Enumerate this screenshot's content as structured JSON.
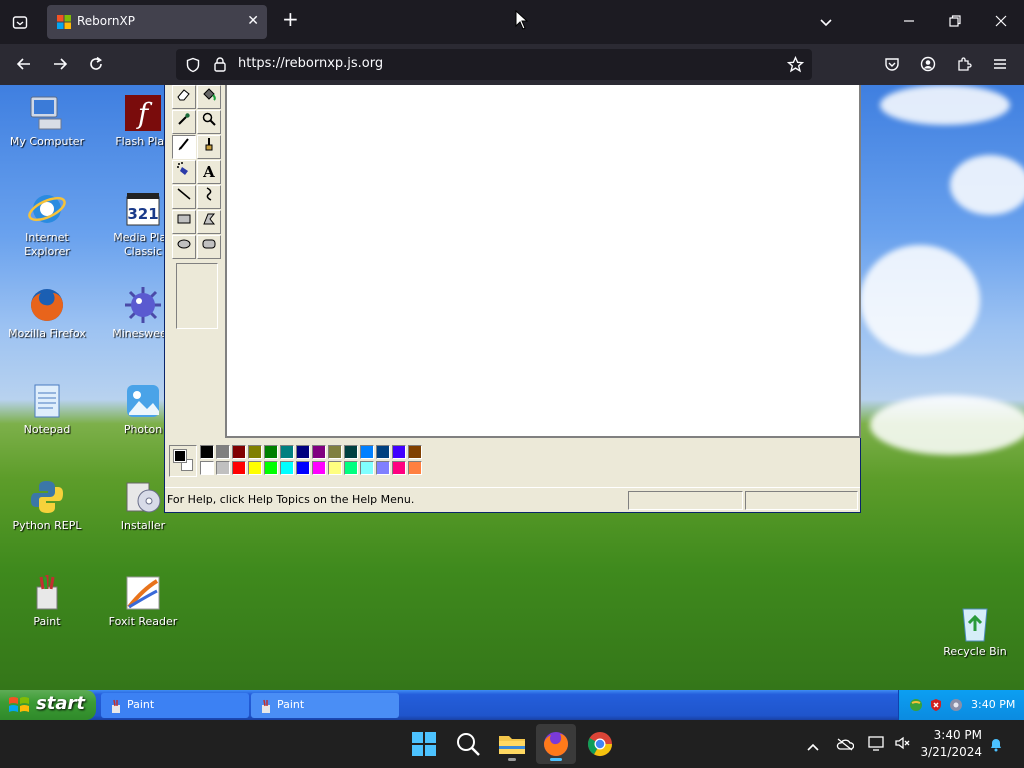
{
  "browser": {
    "tab_title": "RebornXP",
    "url": "https://rebornxp.js.org",
    "new_tab_symbol": "+",
    "close_symbol": "✕"
  },
  "desktop": {
    "icons": [
      {
        "label": "My Computer"
      },
      {
        "label": "Flash Play"
      },
      {
        "label": "Internet\nExplorer"
      },
      {
        "label": "Media Play\nClassic"
      },
      {
        "label": "Mozilla Firefox"
      },
      {
        "label": "Minesweep"
      },
      {
        "label": "Notepad"
      },
      {
        "label": "Photon"
      },
      {
        "label": "Python REPL"
      },
      {
        "label": "Installer"
      },
      {
        "label": "Paint"
      },
      {
        "label": "Foxit Reader"
      },
      {
        "label": "Recycle Bin"
      }
    ]
  },
  "paint": {
    "text_tool_glyph": "A",
    "status": "For Help, click Help Topics on the Help Menu.",
    "palette_top": [
      "#000000",
      "#808080",
      "#800000",
      "#808000",
      "#008000",
      "#008080",
      "#000080",
      "#800080",
      "#808040",
      "#004040",
      "#0080ff",
      "#004080",
      "#4000ff",
      "#804000"
    ],
    "palette_bottom": [
      "#ffffff",
      "#c0c0c0",
      "#ff0000",
      "#ffff00",
      "#00ff00",
      "#00ffff",
      "#0000ff",
      "#ff00ff",
      "#ffff80",
      "#00ff80",
      "#80ffff",
      "#8080ff",
      "#ff0080",
      "#ff8040"
    ]
  },
  "xp_taskbar": {
    "start_label": "start",
    "tasks": [
      "Paint",
      "Paint"
    ],
    "time": "3:40 PM"
  },
  "win_taskbar": {
    "time": "3:40 PM",
    "date": "3/21/2024"
  }
}
